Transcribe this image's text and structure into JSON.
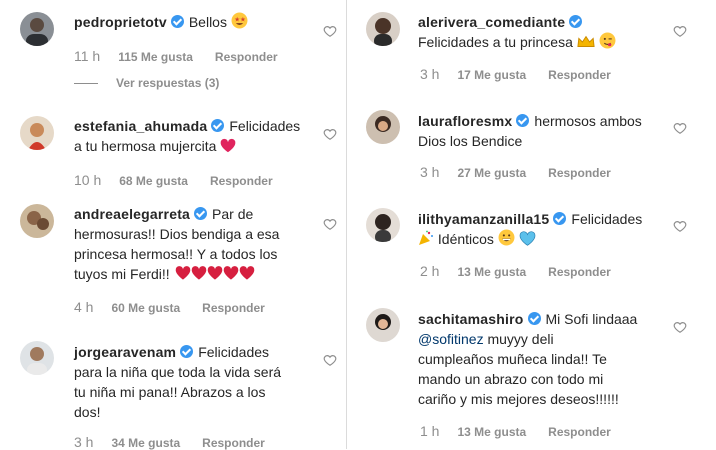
{
  "icons": {
    "like": "heart-outline-icon",
    "verified": "verified-badge-icon"
  },
  "colors": {
    "verified": "#3897f0",
    "meta": "#8e8e8e",
    "text": "#262626",
    "mention": "#00376b"
  },
  "left": [
    {
      "user": "pedroprietotv",
      "text": "Bellos",
      "emoji": "star-struck",
      "time": "11 h",
      "likes": "115 Me gusta",
      "reply": "Responder",
      "replies": "Ver respuestas (3)"
    },
    {
      "user": "estefania_ahumada",
      "text_line1": "Felicidades",
      "text_line2": "a tu hermosa mujercita",
      "emoji": "red-heart",
      "time": "10 h",
      "likes": "68 Me gusta",
      "reply": "Responder"
    },
    {
      "user": "andreaelegarreta",
      "text_line1": "Par de",
      "text_line2": "hermosuras!! Dios bendiga a esa",
      "text_line3": "princesa hermosa!! Y a todos los",
      "text_line4": "tuyos mi Ferdi!!",
      "emoji": "growing-heart x5",
      "time": "4 h",
      "likes": "60 Me gusta",
      "reply": "Responder"
    },
    {
      "user": "jorgearavenam",
      "text_line1": "Felicidades",
      "text_line2": "para la niña que toda la vida será",
      "text_line3": "tu niña mi pana!! Abrazos a los",
      "text_line4": "dos!",
      "time": "3 h",
      "likes": "34 Me gusta",
      "reply": "Responder"
    }
  ],
  "right": [
    {
      "user": "alerivera_comediante",
      "text": "Felicidades a tu princesa",
      "emoji": "crown, face-savoring-food",
      "time": "3 h",
      "likes": "17 Me gusta",
      "reply": "Responder"
    },
    {
      "user": "laurafloresmx",
      "text_line1": "hermosos ambos",
      "text_line2": "Dios los Bendice",
      "time": "3 h",
      "likes": "27 Me gusta",
      "reply": "Responder"
    },
    {
      "user": "ilithyamanzanilla15",
      "text_line1": "Felicidades",
      "text_line2": "Idénticos",
      "emoji": "party-popper, grinning-face, blue-heart",
      "time": "2 h",
      "likes": "13 Me gusta",
      "reply": "Responder"
    },
    {
      "user": "sachitamashiro",
      "text_line1": "Mi Sofi lindaaa",
      "mention": "@sofitinez",
      "text_line2": "muyyy deli",
      "text_line3": "cumpleaños muñeca linda!! Te",
      "text_line4": "mando un abrazo con todo mi",
      "text_line5": "cariño y mis mejores deseos!!!!!!",
      "time": "1 h",
      "likes": "13 Me gusta",
      "reply": "Responder"
    }
  ]
}
